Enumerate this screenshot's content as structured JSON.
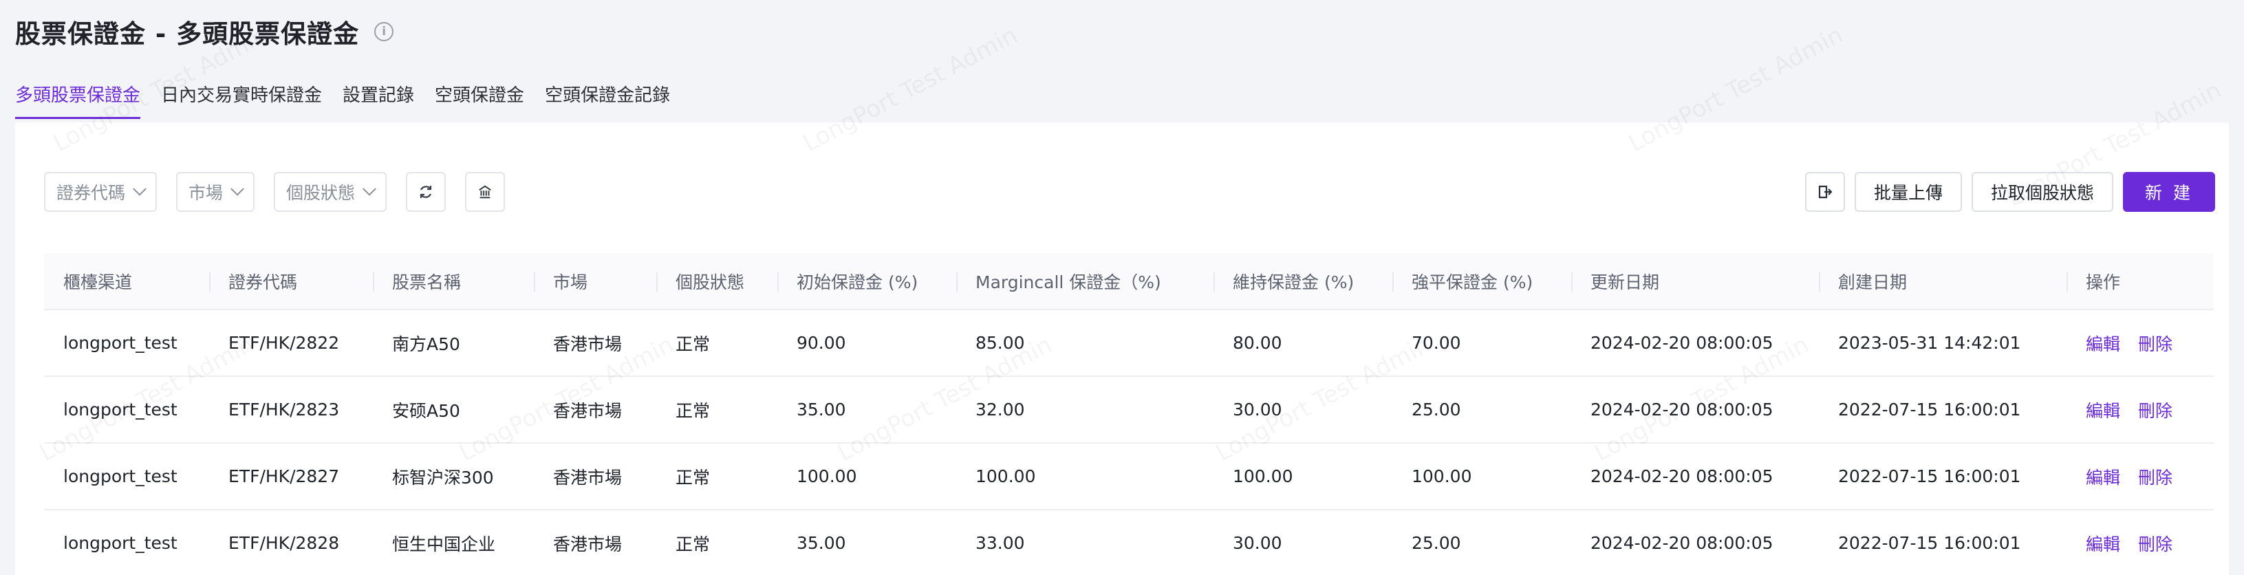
{
  "header": {
    "title": "股票保證金 - 多頭股票保證金",
    "info_icon": "info-icon"
  },
  "tabs": [
    {
      "label": "多頭股票保證金",
      "active": true
    },
    {
      "label": "日內交易實時保證金",
      "active": false
    },
    {
      "label": "設置記錄",
      "active": false
    },
    {
      "label": "空頭保證金",
      "active": false
    },
    {
      "label": "空頭保證金記錄",
      "active": false
    }
  ],
  "filters": [
    {
      "label": "證券代碼"
    },
    {
      "label": "市場"
    },
    {
      "label": "個股狀態"
    }
  ],
  "toolbar": {
    "refresh_icon": "refresh-icon",
    "bank_icon": "bank-icon",
    "export_icon": "export-icon",
    "batch_upload": "批量上傳",
    "pull_status": "拉取個股狀態",
    "create": "新 建"
  },
  "table": {
    "columns": [
      "櫃檯渠道",
      "證券代碼",
      "股票名稱",
      "市場",
      "個股狀態",
      "初始保證金 (%)",
      "Margincall 保證金（%)",
      "維持保證金 (%)",
      "強平保證金 (%)",
      "更新日期",
      "創建日期",
      "操作"
    ],
    "rows": [
      [
        "longport_test",
        "ETF/HK/2822",
        "南方A50",
        "香港市場",
        "正常",
        "90.00",
        "85.00",
        "80.00",
        "70.00",
        "2024-02-20 08:00:05",
        "2023-05-31 14:42:01"
      ],
      [
        "longport_test",
        "ETF/HK/2823",
        "安硕A50",
        "香港市場",
        "正常",
        "35.00",
        "32.00",
        "30.00",
        "25.00",
        "2024-02-20 08:00:05",
        "2022-07-15 16:00:01"
      ],
      [
        "longport_test",
        "ETF/HK/2827",
        "标智沪深300",
        "香港市場",
        "正常",
        "100.00",
        "100.00",
        "100.00",
        "100.00",
        "2024-02-20 08:00:05",
        "2022-07-15 16:00:01"
      ],
      [
        "longport_test",
        "ETF/HK/2828",
        "恒生中国企业",
        "香港市場",
        "正常",
        "35.00",
        "33.00",
        "30.00",
        "25.00",
        "2024-02-20 08:00:05",
        "2022-07-15 16:00:01"
      ]
    ],
    "actions": {
      "edit": "編輯",
      "delete": "刪除"
    }
  },
  "watermark": "LongPort Test Admin",
  "colors": {
    "accent": "#6c2bd9",
    "background": "#f3f4f7"
  }
}
